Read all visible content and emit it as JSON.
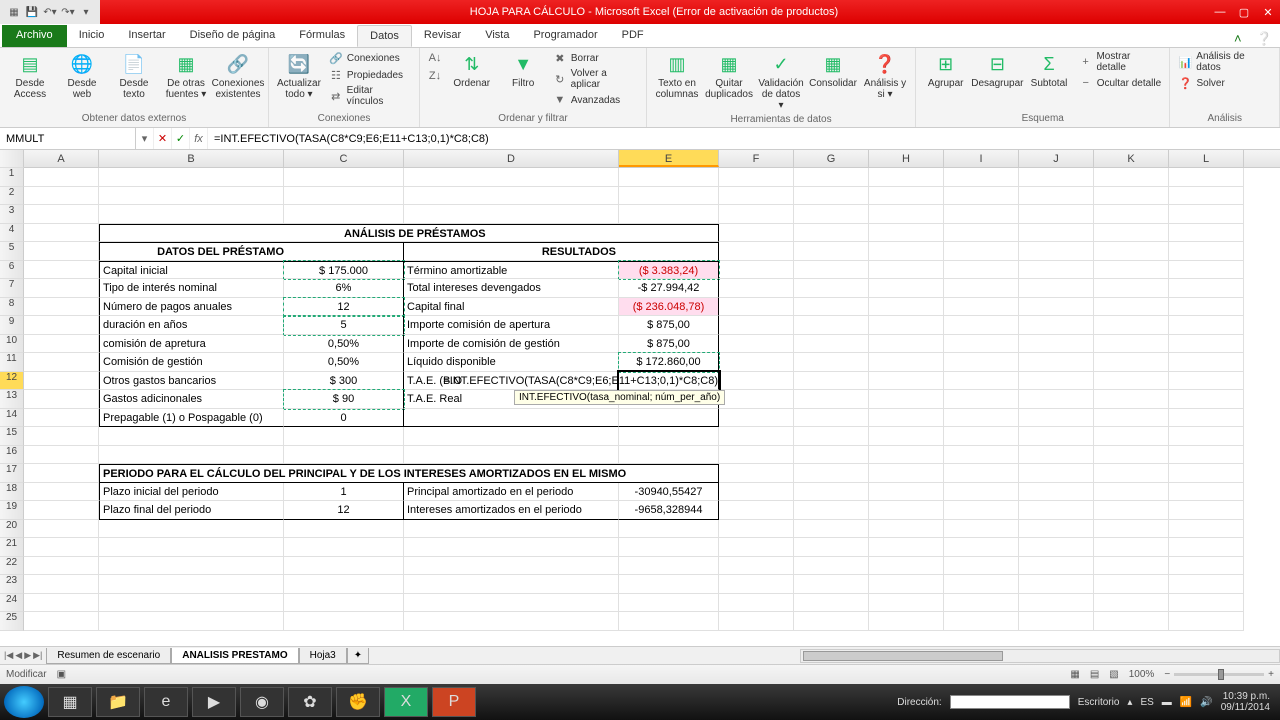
{
  "app": {
    "title": "HOJA PARA CÁLCULO - Microsoft Excel (Error de activación de productos)"
  },
  "tabs": {
    "file": "Archivo",
    "items": [
      "Inicio",
      "Insertar",
      "Diseño de página",
      "Fórmulas",
      "Datos",
      "Revisar",
      "Vista",
      "Programador",
      "PDF"
    ],
    "active": "Datos"
  },
  "ribbon": {
    "g1": {
      "label": "Obtener datos externos",
      "b": [
        "Desde Access",
        "Desde web",
        "Desde texto",
        "De otras fuentes ▾",
        "Conexiones existentes"
      ]
    },
    "g2": {
      "label": "Conexiones",
      "main": "Actualizar todo ▾",
      "s": [
        "Conexiones",
        "Propiedades",
        "Editar vínculos"
      ]
    },
    "g3": {
      "label": "Ordenar y filtrar",
      "sort": "Ordenar",
      "filter": "Filtro",
      "s": [
        "Borrar",
        "Volver a aplicar",
        "Avanzadas"
      ]
    },
    "g4": {
      "label": "Herramientas de datos",
      "b": [
        "Texto en columnas",
        "Quitar duplicados",
        "Validación de datos ▾",
        "Consolidar",
        "Análisis y si ▾"
      ]
    },
    "g5": {
      "label": "Esquema",
      "b": [
        "Agrupar",
        "Desagrupar",
        "Subtotal"
      ],
      "s": [
        "Mostrar detalle",
        "Ocultar detalle"
      ]
    },
    "g6": {
      "label": "Análisis",
      "s": [
        "Análisis de datos",
        "Solver"
      ]
    }
  },
  "formula": {
    "namebox": "MMULT",
    "value": "=INT.EFECTIVO(TASA(C8*C9;E6;E11+C13;0,1)*C8;C8)"
  },
  "cols": [
    "",
    "A",
    "B",
    "C",
    "D",
    "E",
    "F",
    "G",
    "H",
    "I",
    "J",
    "K",
    "L"
  ],
  "sheet": {
    "r4": {
      "title": "ANÁLISIS DE PRÉSTAMOS"
    },
    "r5": {
      "left": "DATOS DEL PRÉSTAMO",
      "right": "RESULTADOS"
    },
    "r6": {
      "b": "Capital inicial",
      "c": "$ 175.000",
      "d": "Término amortizable",
      "e": "($ 3.383,24)"
    },
    "r7": {
      "b": "Tipo de interés nominal",
      "c": "6%",
      "d": "Total intereses devengados",
      "e": "-$ 27.994,42"
    },
    "r8": {
      "b": "Número de pagos anuales",
      "c": "12",
      "d": "Capital final",
      "e": "($ 236.048,78)"
    },
    "r9": {
      "b": "duración en años",
      "c": "5",
      "d": "Importe comisión de apertura",
      "e": "$ 875,00"
    },
    "r10": {
      "b": "comisión de apretura",
      "c": "0,50%",
      "d": "Importe de comisión de gestión",
      "e": "$ 875,00"
    },
    "r11": {
      "b": "Comisión de gestión",
      "c": "0,50%",
      "d": "Líquido disponible",
      "e": "$ 172.860,00"
    },
    "r12": {
      "b": "Otros gastos bancarios",
      "c": "$ 300",
      "d": "T.A.E. (B.O",
      "formula": "=INT.EFECTIVO(TASA(C8*C9;E6;E11+C13;0,1)*C8;C8)"
    },
    "r13": {
      "b": "Gastos adicinonales",
      "c": "$ 90",
      "d": "T.A.E. Real"
    },
    "r14": {
      "b": "Prepagable (1) o Pospagable (0)",
      "c": "0"
    },
    "r17": {
      "title": "PERIODO PARA EL CÁLCULO DEL PRINCIPAL Y DE LOS INTERESES AMORTIZADOS EN EL MISMO"
    },
    "r18": {
      "b": "Plazo inicial del periodo",
      "c": "1",
      "d": "Principal amortizado en el periodo",
      "e": "-30940,55427"
    },
    "r19": {
      "b": "Plazo final del periodo",
      "c": "12",
      "d": "Intereses amortizados en el periodo",
      "e": "-9658,328944"
    },
    "tooltip": "INT.EFECTIVO(tasa_nominal; núm_per_año)"
  },
  "sheets": [
    "Resumen de escenario",
    "ANALISIS PRESTAMO",
    "Hoja3"
  ],
  "status": {
    "mode": "Modificar",
    "direccion": "Dirección:",
    "escritorio": "Escritorio",
    "zoom": "100%"
  },
  "taskbar": {
    "lang": "ES",
    "time": "10:39 p.m.",
    "date": "09/11/2014"
  }
}
